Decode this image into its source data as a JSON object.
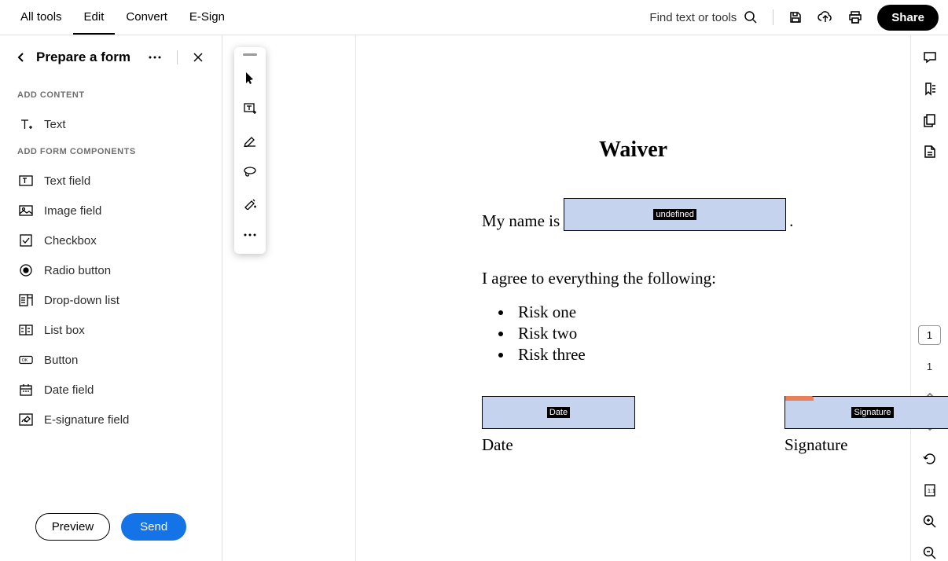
{
  "top": {
    "tabs": [
      "All tools",
      "Edit",
      "Convert",
      "E-Sign"
    ],
    "active_tab_index": 1,
    "search_label": "Find text or tools",
    "share_label": "Share"
  },
  "left_panel": {
    "title": "Prepare a form",
    "section1_label": "ADD CONTENT",
    "section2_label": "ADD FORM COMPONENTS",
    "text_tool": "Text",
    "components": [
      "Text field",
      "Image field",
      "Checkbox",
      "Radio button",
      "Drop-down list",
      "List box",
      "Button",
      "Date field",
      "E-signature field"
    ],
    "preview_label": "Preview",
    "send_label": "Send"
  },
  "document": {
    "title": "Waiver",
    "line_prefix": "My name is",
    "line_suffix": ".",
    "name_field_label": "undefined",
    "paragraph": "I agree to everything the following:",
    "risks": [
      "Risk one",
      "Risk two",
      "Risk three"
    ],
    "date_field_label": "Date",
    "date_caption": "Date",
    "sig_field_label": "Signature",
    "sig_caption": "Signature"
  },
  "right": {
    "current_page": "1",
    "total_pages": "1"
  }
}
